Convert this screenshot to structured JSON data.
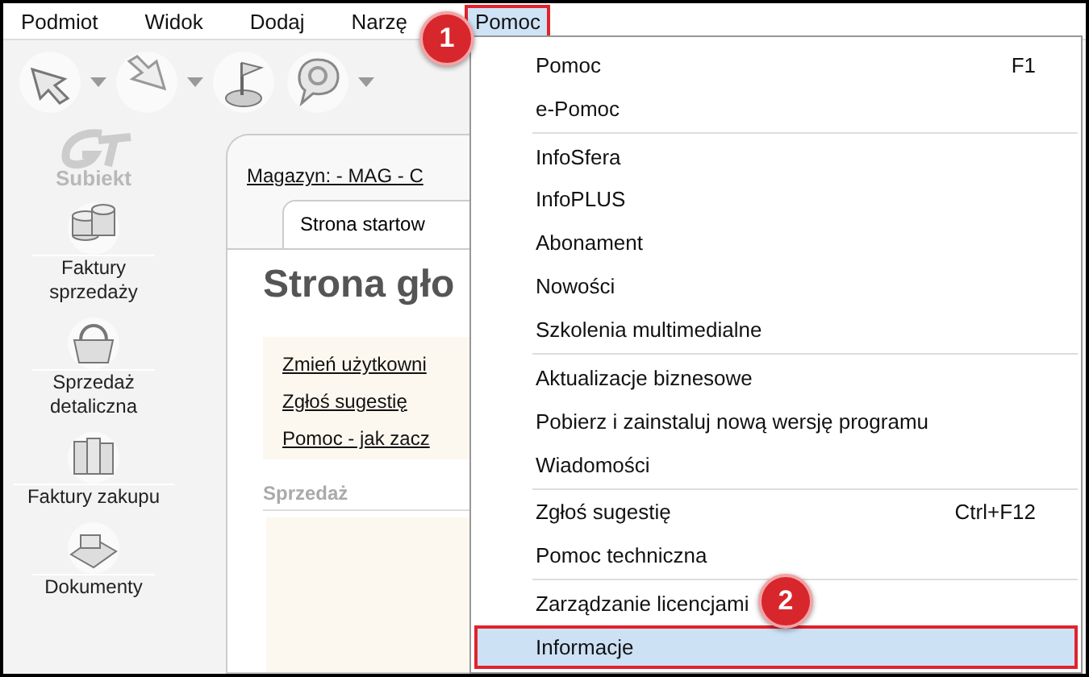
{
  "menu_bar": [
    {
      "label": "Podmiot",
      "selected": false
    },
    {
      "label": "Widok",
      "selected": false
    },
    {
      "label": "Dodaj",
      "selected": false
    },
    {
      "label": "Narzę",
      "selected": false
    },
    {
      "label": "Pomoc",
      "selected": true
    }
  ],
  "callouts": [
    {
      "label": "1",
      "kind": "menu"
    },
    {
      "label": "2",
      "kind": "item"
    }
  ],
  "logo": {
    "label": "Subiekt"
  },
  "sidebar": {
    "items": [
      {
        "label": "Faktury sprzedaży",
        "kind": "coins"
      },
      {
        "label": "Sprzedaż detaliczna",
        "kind": "basket"
      },
      {
        "label": "Faktury zakupu",
        "kind": "binders"
      },
      {
        "label": "Dokumenty",
        "kind": "register"
      }
    ]
  },
  "main": {
    "location_link": "Magazyn: - MAG - C",
    "tab": "Strona startow",
    "heading": "Strona gło",
    "links": [
      "Zmień użytkowni",
      "Zgłoś sugestię",
      "Pomoc - jak zacz"
    ],
    "section": "Sprzedaż"
  },
  "dropdown": {
    "groups": [
      [
        {
          "label": "Pomoc",
          "shortcut": "F1",
          "selected": false
        },
        {
          "label": "e-Pomoc",
          "selected": false
        }
      ],
      [
        {
          "label": "InfoSfera",
          "selected": false
        },
        {
          "label": "InfoPLUS",
          "selected": false
        },
        {
          "label": "Abonament",
          "selected": false
        },
        {
          "label": "Nowości",
          "selected": false
        },
        {
          "label": "Szkolenia multimedialne",
          "selected": false
        }
      ],
      [
        {
          "label": "Aktualizacje biznesowe",
          "selected": false
        },
        {
          "label": "Pobierz i zainstaluj nową wersję programu",
          "selected": false
        },
        {
          "label": "Wiadomości",
          "selected": false
        }
      ],
      [
        {
          "label": "Zgłoś sugestię",
          "shortcut": "Ctrl+F12",
          "selected": false
        },
        {
          "label": "Pomoc techniczna",
          "selected": false
        }
      ],
      [
        {
          "label": "Zarządzanie licencjami",
          "selected": false
        },
        {
          "label": "Informacje",
          "selected": true
        }
      ]
    ]
  }
}
